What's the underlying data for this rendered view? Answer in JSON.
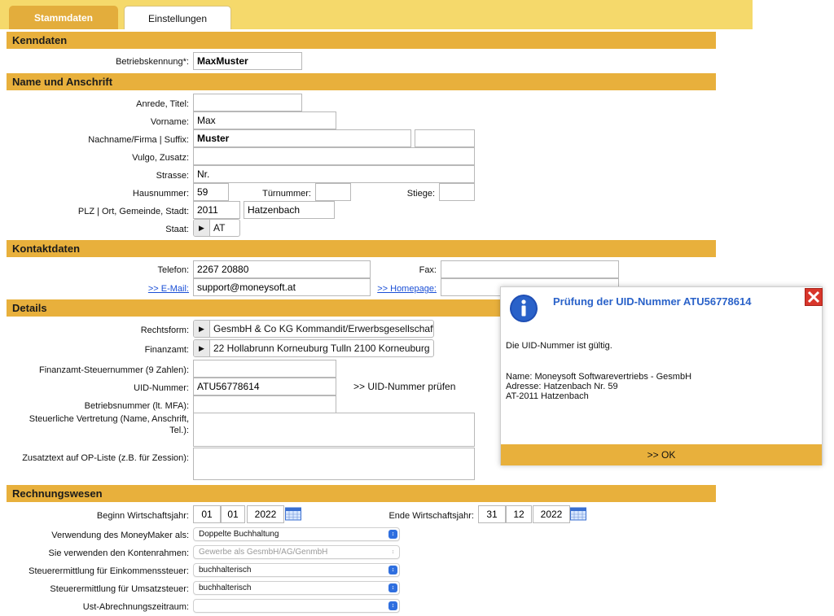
{
  "tabs": [
    {
      "label": "Stammdaten",
      "active": true
    },
    {
      "label": "Einstellungen",
      "active": false
    }
  ],
  "kenndaten": {
    "title": "Kenndaten",
    "betriebskennung_label": "Betriebskennung*:",
    "betriebskennung_value": "MaxMuster"
  },
  "name": {
    "title": "Name und Anschrift",
    "anrede_label": "Anrede, Titel:",
    "anrede_value": "",
    "vorname_label": "Vorname:",
    "vorname_value": "Max",
    "nachname_label": "Nachname/Firma | Suffix:",
    "nachname_value": "Muster",
    "suffix_value": "",
    "vulgo_label": "Vulgo, Zusatz:",
    "vulgo_value": "",
    "strasse_label": "Strasse:",
    "strasse_value": "Nr.",
    "hausnummer_label": "Hausnummer:",
    "hausnummer_value": "59",
    "tuernummer_label": "Türnummer:",
    "tuernummer_value": "",
    "stiege_label": "Stiege:",
    "stiege_value": "",
    "plz_label": "PLZ | Ort, Gemeinde, Stadt:",
    "plz_value": "2011",
    "ort_value": "Hatzenbach",
    "staat_label": "Staat:",
    "staat_value": "AT"
  },
  "kontakt": {
    "title": "Kontaktdaten",
    "telefon_label": "Telefon:",
    "telefon_value": "2267 20880",
    "fax_label": "Fax:",
    "fax_value": "",
    "email_label": ">> E-Mail:",
    "email_value": "support@moneysoft.at",
    "homepage_label": ">> Homepage:",
    "homepage_value": ""
  },
  "details": {
    "title": "Details",
    "rechtsform_label": "Rechtsform:",
    "rechtsform_value": "GesmbH & Co KG Kommandit/Erwerbsgesellschaft",
    "finanzamt_label": "Finanzamt:",
    "finanzamt_value": "22 Hollabrunn Korneuburg Tulln 2100 Korneuburg",
    "steuernr_label": "Finanzamt-Steuernummer (9 Zahlen):",
    "steuernr_value": "",
    "uid_label": "UID-Nummer:",
    "uid_value": "ATU56778614",
    "uid_check_link": ">> UID-Nummer prüfen",
    "betriebsnr_label": "Betriebsnummer (lt. MFA):",
    "betriebsnr_value": "",
    "vertretung_label": "Steuerliche Vertretung (Name, Anschrift, Tel.):",
    "vertretung_value": "",
    "zusatztext_label": "Zusatztext auf OP-Liste (z.B. für Zession):",
    "zusatztext_value": ""
  },
  "rechnung": {
    "title": "Rechnungswesen",
    "beginn_label": "Beginn Wirtschaftsjahr:",
    "beginn_day": "01",
    "beginn_month": "01",
    "beginn_year": "2022",
    "ende_label": "Ende Wirtschaftsjahr:",
    "ende_day": "31",
    "ende_month": "12",
    "ende_year": "2022",
    "verwendung_label": "Verwendung des MoneyMaker als:",
    "verwendung_value": "Doppelte Buchhaltung",
    "kontenrahmen_label": "Sie verwenden den Kontenrahmen:",
    "kontenrahmen_value": "Gewerbe als GesmbH/AG/GenmbH",
    "est_label": "Steuerermittlung für Einkommenssteuer:",
    "est_value": "buchhalterisch",
    "ust_label": "Steuerermittlung für Umsatzsteuer:",
    "ust_value": "buchhalterisch",
    "zeitraum_label": "Ust-Abrechnungszeitraum:",
    "zeitraum_value": ""
  },
  "dialog": {
    "title": "Prüfung der UID-Nummer ATU56778614",
    "message": "Die UID-Nummer ist gültig.",
    "name_line": "Name: Moneysoft Softwarevertriebs - GesmbH",
    "address_line": "Adresse: Hatzenbach Nr. 59",
    "city_line": "AT-2011 Hatzenbach",
    "ok_label": ">> OK",
    "icon": "info-icon",
    "close_icon": "close-icon"
  },
  "colors": {
    "accent": "#e8b03c",
    "tabbar": "#f5d96b",
    "link": "#1a4fd6",
    "dialog_title": "#2a62c9",
    "close_red": "#d8362b"
  }
}
